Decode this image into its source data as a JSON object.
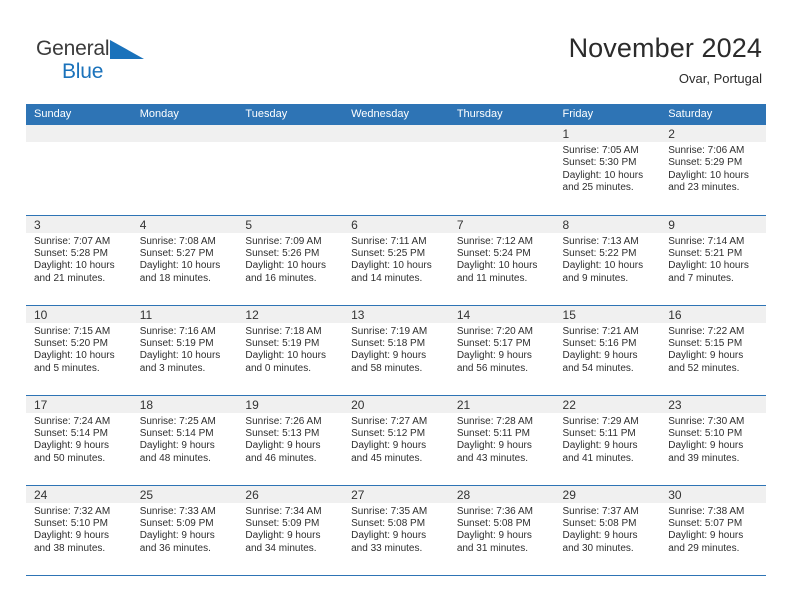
{
  "brand": {
    "name_part1": "General",
    "name_part2": "Blue",
    "logo_icon": "blue-triangle-icon",
    "accent_color": "#1a72bb"
  },
  "header": {
    "title": "November 2024",
    "subtitle": "Ovar, Portugal"
  },
  "theme": {
    "header_blue": "#2e74b5",
    "date_band_gray": "#f0f0f0",
    "text_dark": "#2e2e2e"
  },
  "calendar": {
    "weekday_headers": [
      "Sunday",
      "Monday",
      "Tuesday",
      "Wednesday",
      "Thursday",
      "Friday",
      "Saturday"
    ],
    "weeks": [
      [
        {
          "day": "",
          "empty": true
        },
        {
          "day": "",
          "empty": true
        },
        {
          "day": "",
          "empty": true
        },
        {
          "day": "",
          "empty": true
        },
        {
          "day": "",
          "empty": true
        },
        {
          "day": "1",
          "sunrise": "Sunrise: 7:05 AM",
          "sunset": "Sunset: 5:30 PM",
          "daylight1": "Daylight: 10 hours",
          "daylight2": "and 25 minutes."
        },
        {
          "day": "2",
          "sunrise": "Sunrise: 7:06 AM",
          "sunset": "Sunset: 5:29 PM",
          "daylight1": "Daylight: 10 hours",
          "daylight2": "and 23 minutes."
        }
      ],
      [
        {
          "day": "3",
          "sunrise": "Sunrise: 7:07 AM",
          "sunset": "Sunset: 5:28 PM",
          "daylight1": "Daylight: 10 hours",
          "daylight2": "and 21 minutes."
        },
        {
          "day": "4",
          "sunrise": "Sunrise: 7:08 AM",
          "sunset": "Sunset: 5:27 PM",
          "daylight1": "Daylight: 10 hours",
          "daylight2": "and 18 minutes."
        },
        {
          "day": "5",
          "sunrise": "Sunrise: 7:09 AM",
          "sunset": "Sunset: 5:26 PM",
          "daylight1": "Daylight: 10 hours",
          "daylight2": "and 16 minutes."
        },
        {
          "day": "6",
          "sunrise": "Sunrise: 7:11 AM",
          "sunset": "Sunset: 5:25 PM",
          "daylight1": "Daylight: 10 hours",
          "daylight2": "and 14 minutes."
        },
        {
          "day": "7",
          "sunrise": "Sunrise: 7:12 AM",
          "sunset": "Sunset: 5:24 PM",
          "daylight1": "Daylight: 10 hours",
          "daylight2": "and 11 minutes."
        },
        {
          "day": "8",
          "sunrise": "Sunrise: 7:13 AM",
          "sunset": "Sunset: 5:22 PM",
          "daylight1": "Daylight: 10 hours",
          "daylight2": "and 9 minutes."
        },
        {
          "day": "9",
          "sunrise": "Sunrise: 7:14 AM",
          "sunset": "Sunset: 5:21 PM",
          "daylight1": "Daylight: 10 hours",
          "daylight2": "and 7 minutes."
        }
      ],
      [
        {
          "day": "10",
          "sunrise": "Sunrise: 7:15 AM",
          "sunset": "Sunset: 5:20 PM",
          "daylight1": "Daylight: 10 hours",
          "daylight2": "and 5 minutes."
        },
        {
          "day": "11",
          "sunrise": "Sunrise: 7:16 AM",
          "sunset": "Sunset: 5:19 PM",
          "daylight1": "Daylight: 10 hours",
          "daylight2": "and 3 minutes."
        },
        {
          "day": "12",
          "sunrise": "Sunrise: 7:18 AM",
          "sunset": "Sunset: 5:19 PM",
          "daylight1": "Daylight: 10 hours",
          "daylight2": "and 0 minutes."
        },
        {
          "day": "13",
          "sunrise": "Sunrise: 7:19 AM",
          "sunset": "Sunset: 5:18 PM",
          "daylight1": "Daylight: 9 hours",
          "daylight2": "and 58 minutes."
        },
        {
          "day": "14",
          "sunrise": "Sunrise: 7:20 AM",
          "sunset": "Sunset: 5:17 PM",
          "daylight1": "Daylight: 9 hours",
          "daylight2": "and 56 minutes."
        },
        {
          "day": "15",
          "sunrise": "Sunrise: 7:21 AM",
          "sunset": "Sunset: 5:16 PM",
          "daylight1": "Daylight: 9 hours",
          "daylight2": "and 54 minutes."
        },
        {
          "day": "16",
          "sunrise": "Sunrise: 7:22 AM",
          "sunset": "Sunset: 5:15 PM",
          "daylight1": "Daylight: 9 hours",
          "daylight2": "and 52 minutes."
        }
      ],
      [
        {
          "day": "17",
          "sunrise": "Sunrise: 7:24 AM",
          "sunset": "Sunset: 5:14 PM",
          "daylight1": "Daylight: 9 hours",
          "daylight2": "and 50 minutes."
        },
        {
          "day": "18",
          "sunrise": "Sunrise: 7:25 AM",
          "sunset": "Sunset: 5:14 PM",
          "daylight1": "Daylight: 9 hours",
          "daylight2": "and 48 minutes."
        },
        {
          "day": "19",
          "sunrise": "Sunrise: 7:26 AM",
          "sunset": "Sunset: 5:13 PM",
          "daylight1": "Daylight: 9 hours",
          "daylight2": "and 46 minutes."
        },
        {
          "day": "20",
          "sunrise": "Sunrise: 7:27 AM",
          "sunset": "Sunset: 5:12 PM",
          "daylight1": "Daylight: 9 hours",
          "daylight2": "and 45 minutes."
        },
        {
          "day": "21",
          "sunrise": "Sunrise: 7:28 AM",
          "sunset": "Sunset: 5:11 PM",
          "daylight1": "Daylight: 9 hours",
          "daylight2": "and 43 minutes."
        },
        {
          "day": "22",
          "sunrise": "Sunrise: 7:29 AM",
          "sunset": "Sunset: 5:11 PM",
          "daylight1": "Daylight: 9 hours",
          "daylight2": "and 41 minutes."
        },
        {
          "day": "23",
          "sunrise": "Sunrise: 7:30 AM",
          "sunset": "Sunset: 5:10 PM",
          "daylight1": "Daylight: 9 hours",
          "daylight2": "and 39 minutes."
        }
      ],
      [
        {
          "day": "24",
          "sunrise": "Sunrise: 7:32 AM",
          "sunset": "Sunset: 5:10 PM",
          "daylight1": "Daylight: 9 hours",
          "daylight2": "and 38 minutes."
        },
        {
          "day": "25",
          "sunrise": "Sunrise: 7:33 AM",
          "sunset": "Sunset: 5:09 PM",
          "daylight1": "Daylight: 9 hours",
          "daylight2": "and 36 minutes."
        },
        {
          "day": "26",
          "sunrise": "Sunrise: 7:34 AM",
          "sunset": "Sunset: 5:09 PM",
          "daylight1": "Daylight: 9 hours",
          "daylight2": "and 34 minutes."
        },
        {
          "day": "27",
          "sunrise": "Sunrise: 7:35 AM",
          "sunset": "Sunset: 5:08 PM",
          "daylight1": "Daylight: 9 hours",
          "daylight2": "and 33 minutes."
        },
        {
          "day": "28",
          "sunrise": "Sunrise: 7:36 AM",
          "sunset": "Sunset: 5:08 PM",
          "daylight1": "Daylight: 9 hours",
          "daylight2": "and 31 minutes."
        },
        {
          "day": "29",
          "sunrise": "Sunrise: 7:37 AM",
          "sunset": "Sunset: 5:08 PM",
          "daylight1": "Daylight: 9 hours",
          "daylight2": "and 30 minutes."
        },
        {
          "day": "30",
          "sunrise": "Sunrise: 7:38 AM",
          "sunset": "Sunset: 5:07 PM",
          "daylight1": "Daylight: 9 hours",
          "daylight2": "and 29 minutes."
        }
      ]
    ]
  }
}
